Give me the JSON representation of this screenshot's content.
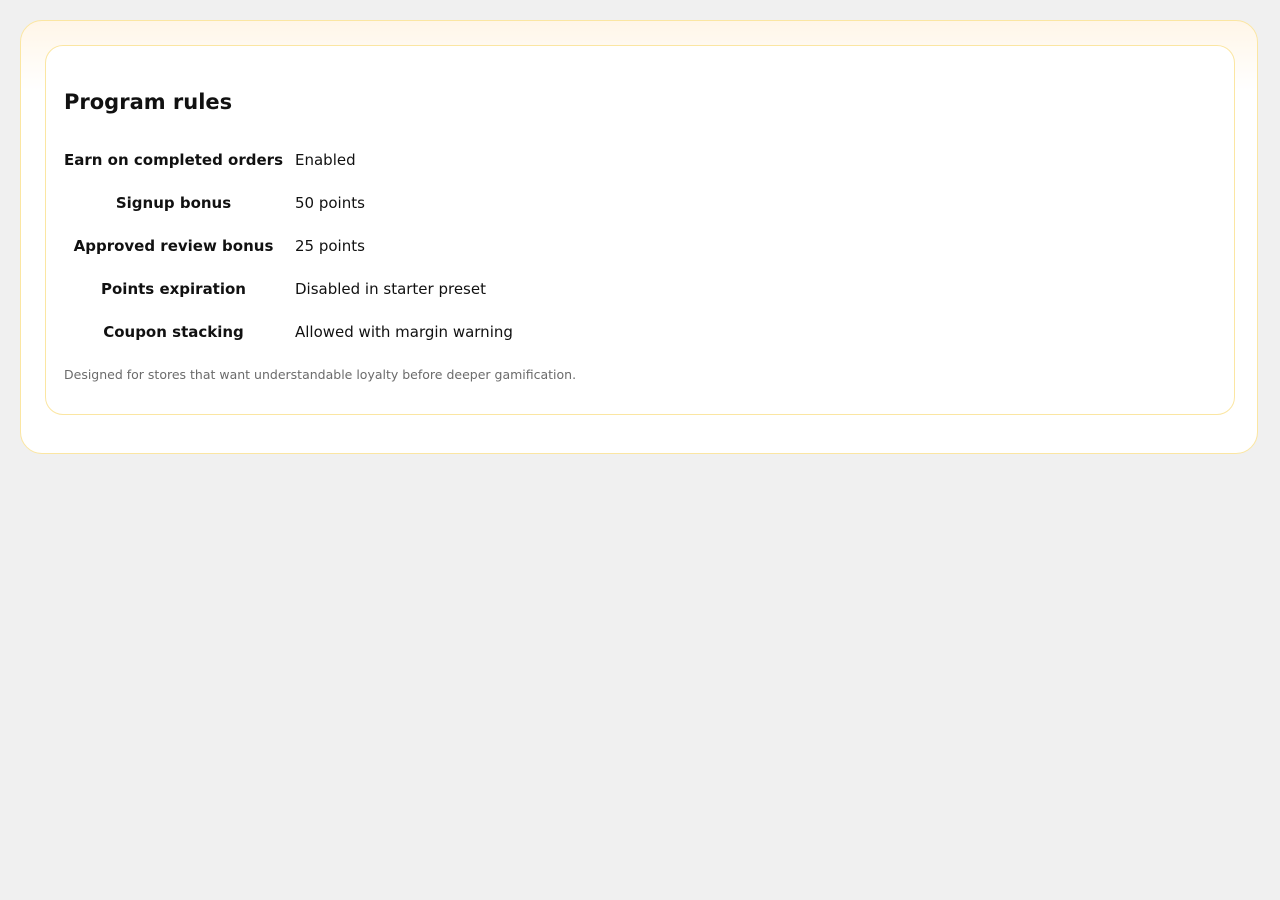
{
  "panel": {
    "title": "Program rules",
    "rules": [
      {
        "label": "Earn on completed orders",
        "value": "Enabled"
      },
      {
        "label": "Signup bonus",
        "value": "50 points"
      },
      {
        "label": "Approved review bonus",
        "value": "25 points"
      },
      {
        "label": "Points expiration",
        "value": "Disabled in starter preset"
      },
      {
        "label": "Coupon stacking",
        "value": "Allowed with margin warning"
      }
    ],
    "note": "Designed for stores that want understandable loyalty before deeper gamification."
  },
  "colors": {
    "background": "#f0f0f0",
    "card_border": "#fbe6a2",
    "card_tint": "#fff6e8",
    "text": "#111111",
    "muted_text": "#6b6b6b"
  }
}
